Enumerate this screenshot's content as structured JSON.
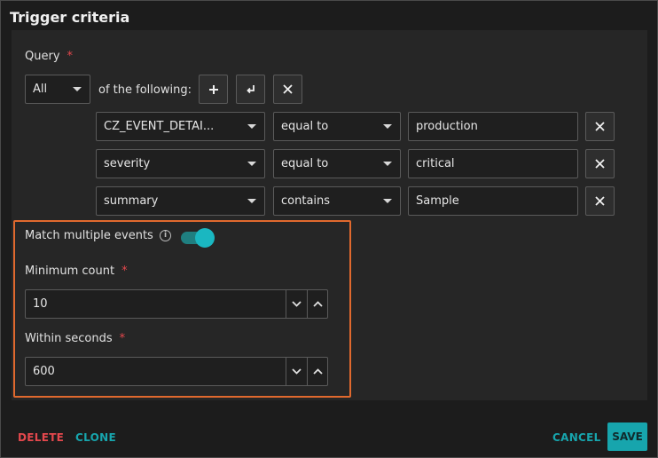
{
  "header": {
    "title": "Trigger criteria"
  },
  "query": {
    "label": "Query",
    "required_mark": "*",
    "match_mode": "All",
    "of_the_following": "of the following:",
    "rows": [
      {
        "field": "CZ_EVENT_DETAI...",
        "operator": "equal to",
        "value": "production"
      },
      {
        "field": "severity",
        "operator": "equal to",
        "value": "critical"
      },
      {
        "field": "summary",
        "operator": "contains",
        "value": "Sample"
      }
    ]
  },
  "match_multiple": {
    "label": "Match multiple events",
    "enabled": true,
    "minimum_count_label": "Minimum count",
    "minimum_count": "10",
    "within_seconds_label": "Within seconds",
    "within_seconds": "600",
    "required_mark": "*"
  },
  "footer": {
    "delete_label": "DELETE",
    "clone_label": "CLONE",
    "cancel_label": "CANCEL",
    "save_label": "SAVE"
  },
  "colors": {
    "accent": "#17a5ad",
    "danger": "#e5484d",
    "highlight": "#e0692e"
  },
  "icons": {
    "add": "plus-icon",
    "nest": "enter-arrow-icon",
    "remove": "x-icon",
    "info": "info-icon",
    "decrement": "chevron-down-icon",
    "increment": "chevron-up-icon"
  }
}
